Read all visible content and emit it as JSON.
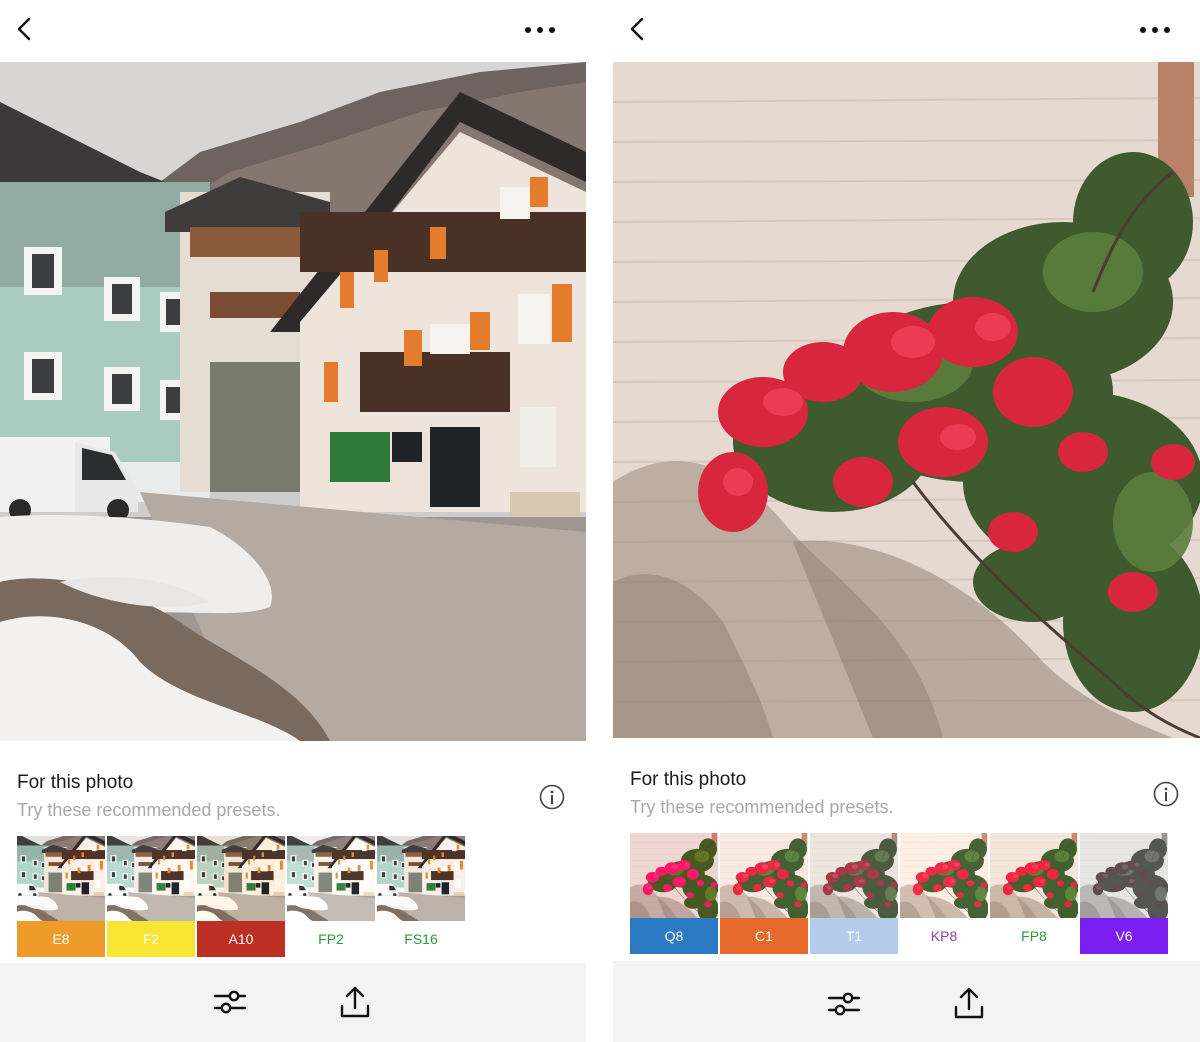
{
  "screens": [
    {
      "photo_subject": "alpine-village-street",
      "section": {
        "title": "For this photo",
        "subtitle": "Try these recommended presets."
      },
      "presets": [
        {
          "label": "E8",
          "bg": "#ef9b2a",
          "fg": "#ffffff"
        },
        {
          "label": "F2",
          "bg": "#f8e534",
          "fg": "#ffffff"
        },
        {
          "label": "A10",
          "bg": "#bd2f22",
          "fg": "#ffffff"
        },
        {
          "label": "FP2",
          "bg": "#ffffff",
          "fg": "#2a9a3c"
        },
        {
          "label": "FS16",
          "bg": "#ffffff",
          "fg": "#2a9a3c"
        }
      ]
    },
    {
      "photo_subject": "bougainvillea-on-brick-wall",
      "section": {
        "title": "For this photo",
        "subtitle": "Try these recommended presets."
      },
      "presets": [
        {
          "label": "Q8",
          "bg": "#2b7bc4",
          "fg": "#ffffff"
        },
        {
          "label": "C1",
          "bg": "#e56a2c",
          "fg": "#ffffff"
        },
        {
          "label": "T1",
          "bg": "#b4cceb",
          "fg": "#ffffff"
        },
        {
          "label": "KP8",
          "bg": "#ffffff",
          "fg": "#a23aa6"
        },
        {
          "label": "FP8",
          "bg": "#ffffff",
          "fg": "#2a9a3c"
        },
        {
          "label": "V6",
          "bg": "#7b1ff0",
          "fg": "#ffffff"
        }
      ]
    }
  ],
  "icons": {
    "back": "chevron-left-icon",
    "more": "more-horizontal-icon",
    "info": "info-circle-icon",
    "adjust": "sliders-icon",
    "share": "share-upload-icon"
  }
}
